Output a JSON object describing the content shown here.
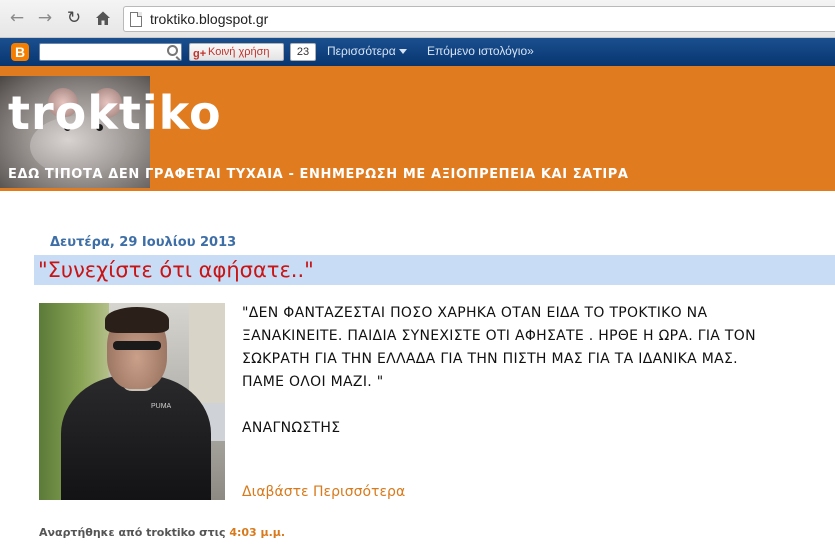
{
  "browser": {
    "url": "troktiko.blogspot.gr"
  },
  "navbar": {
    "logo_letter": "B",
    "share_label": "Κοινή χρήση",
    "share_count": "23",
    "more_label": "Περισσότερα",
    "next_blog_label": "Επόμενο ιστολόγιο»"
  },
  "header": {
    "title": "troktiko",
    "description": "ΕΔΩ ΤΙΠΟΤΑ ΔΕΝ ΓΡΑΦΕΤΑΙ ΤΥΧΑΙΑ - ΕΝΗΜΕΡΩΣΗ ΜΕ ΑΞΙΟΠΡΕΠΕΙΑ ΚΑΙ ΣΑΤΙΡΑ",
    "background_color": "#e07b20"
  },
  "post": {
    "date": "Δευτέρα, 29 Ιουλίου 2013",
    "title": "\"Συνεχίστε ότι αφήσατε..\"",
    "body_lines": [
      "\"ΔΕΝ ΦΑΝΤΑΖΕΣΤΑΙ ΠΟΣΟ ΧΑΡΗΚΑ ΟΤΑΝ ΕΙΔΑ  ΤΟ ΤΡΟΚΤΙΚΟ ΝΑ",
      "ΞΑΝΑΚΙΝΕΙΤΕ. ΠΑΙΔΙΑ ΣΥΝΕΧΙΣΤΕ ΟΤΙ ΑΦΗΣΑΤΕ . ΗΡΘΕ Η ΩΡΑ. ΓΙΑ ΤΟΝ",
      "ΣΩΚΡΑΤΗ ΓΙΑ ΤΗΝ ΕΛΛΑΔΑ ΓΙΑ ΤΗΝ ΠΙΣΤΗ ΜΑΣ ΓΙΑ ΤΑ ΙΔΑΝΙΚΑ ΜΑΣ.",
      "ΠΑΜΕ ΟΛΟΙ ΜΑΖΙ. \""
    ],
    "author_sign": "ΑΝΑΓΝΩΣΤΗΣ",
    "read_more": "Διαβάστε Περισσότερα",
    "photo_logo_text": "PUMA",
    "footer_prefix": "Αναρτήθηκε από troktiko στις",
    "footer_time": "4:03 μ.μ.",
    "title_color": "#c81414",
    "link_color": "#d87a1c"
  }
}
